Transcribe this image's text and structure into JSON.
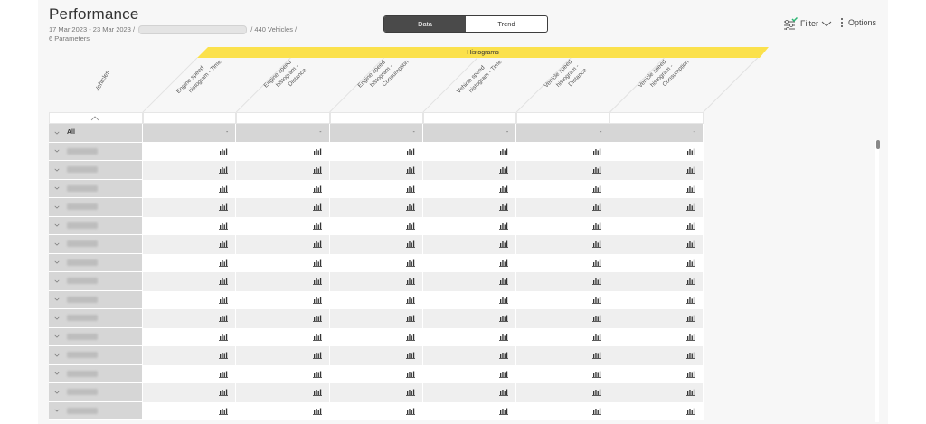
{
  "header": {
    "title": "Performance",
    "date_range": "17 Mar 2023 - 23 Mar 2023 /",
    "vehicles_count": "/ 440 Vehicles /",
    "parameters": "6 Parameters"
  },
  "view_toggle": {
    "data_label": "Data",
    "trend_label": "Trend",
    "selected": "Data"
  },
  "toolbar": {
    "filter_label": "Filter",
    "options_label": "Options"
  },
  "table": {
    "group_label": "Histograms",
    "vehicles_header": "Vehicles",
    "columns": [
      [
        "Engine speed",
        "histogram - Time"
      ],
      [
        "Engine speed",
        "histogram -",
        "Distance"
      ],
      [
        "Engine speed",
        "histogram -",
        "Consumption"
      ],
      [
        "Vehicle speed",
        "histogram - Time"
      ],
      [
        "Vehicle speed",
        "histogram -",
        "Distance"
      ],
      [
        "Vehicle speed",
        "histogram -",
        "Consumption"
      ]
    ],
    "all_row": {
      "label": "All",
      "values": [
        "-",
        "-",
        "-",
        "-",
        "-",
        "-"
      ]
    },
    "vehicle_row_count": 15,
    "cell_icon": "bar-chart-icon"
  },
  "colors": {
    "accent": "#fbe14c",
    "toggle_active": "#4a4a4a",
    "filter_check": "#2bb673"
  }
}
